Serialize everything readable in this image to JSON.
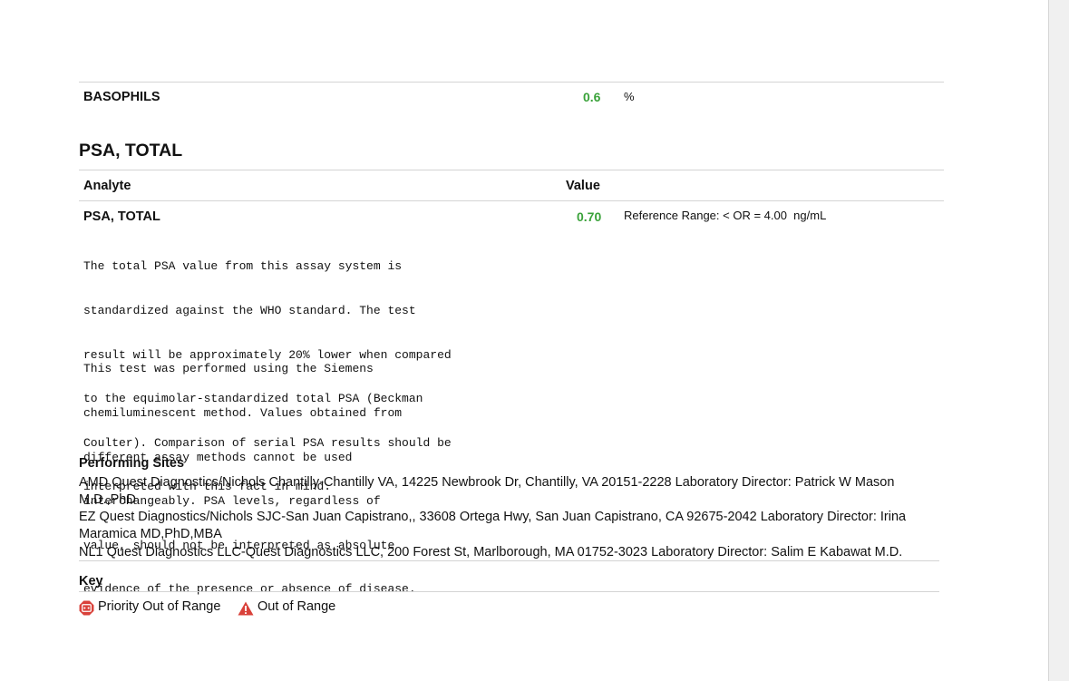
{
  "basophils": {
    "name": "BASOPHILS",
    "value": "0.6",
    "unit": "%"
  },
  "psa_section": {
    "title": "PSA, TOTAL",
    "col_analyte": "Analyte",
    "col_value": "Value",
    "analyte_name": "PSA, TOTAL",
    "value": "0.70",
    "reference": "Reference Range: < OR = 4.00  ng/mL",
    "note_paragraph_1": [
      "The total PSA value from this assay system is",
      "standardized against the WHO standard. The test",
      "result will be approximately 20% lower when compared",
      "to the equimolar-standardized total PSA (Beckman",
      "Coulter). Comparison of serial PSA results should be",
      "interpreted with this fact in mind."
    ],
    "note_paragraph_2": [
      "This test was performed using the Siemens",
      "chemiluminescent method. Values obtained from",
      "different assay methods cannot be used",
      "interchangeably. PSA levels, regardless of",
      "value, should not be interpreted as absolute",
      "evidence of the presence or absence of disease."
    ]
  },
  "performing_sites": {
    "title": "Performing Sites",
    "lines": [
      "AMD Quest Diagnostics/Nichols Chantilly-Chantilly VA, 14225 Newbrook Dr, Chantilly, VA 20151-2228 Laboratory Director: Patrick W Mason",
      "M.D.,PhD",
      "EZ Quest Diagnostics/Nichols SJC-San Juan Capistrano,, 33608 Ortega Hwy, San Juan Capistrano, CA 92675-2042 Laboratory Director: Irina",
      "Maramica MD,PhD,MBA",
      "NL1 Quest Diagnostics LLC-Quest Diagnostics LLC, 200 Forest St, Marlborough, MA 01752-3023 Laboratory Director: Salim E Kabawat M.D."
    ]
  },
  "key": {
    "title": "Key",
    "priority_label": "Priority Out of Range",
    "out_of_range_label": "Out of Range",
    "priority_icon": "priority-octagon-icon",
    "warning_icon": "warning-triangle-icon",
    "priority_color": "#d9413a",
    "warning_color": "#d9413a"
  },
  "colors": {
    "value_green": "#3aa23a",
    "rule": "#d4d4d4"
  }
}
